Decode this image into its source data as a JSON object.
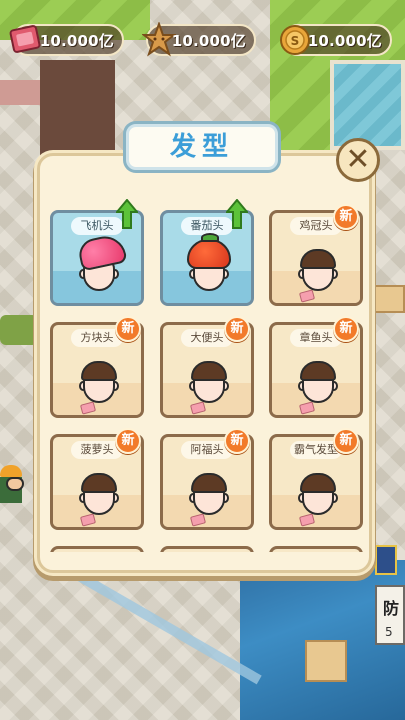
{
  "currency": [
    {
      "icon": "ticket-icon",
      "value": "10.000亿"
    },
    {
      "icon": "star-cookie-icon",
      "value": "10.000亿"
    },
    {
      "icon": "coin-icon",
      "value": "10.000亿"
    }
  ],
  "modal": {
    "title": "发型",
    "close_icon": "close-icon"
  },
  "hairstyles": [
    {
      "name": "飞机头",
      "state": "owned",
      "badge": "upgrade-arrow"
    },
    {
      "name": "番茄头",
      "state": "owned",
      "badge": "upgrade-arrow"
    },
    {
      "name": "鸡冠头",
      "state": "locked",
      "badge": "新"
    },
    {
      "name": "方块头",
      "state": "locked",
      "badge": "新"
    },
    {
      "name": "大便头",
      "state": "locked",
      "badge": "新"
    },
    {
      "name": "章鱼头",
      "state": "locked",
      "badge": "新"
    },
    {
      "name": "菠萝头",
      "state": "locked",
      "badge": "新"
    },
    {
      "name": "阿福头",
      "state": "locked",
      "badge": "新"
    },
    {
      "name": "霸气发型",
      "state": "locked",
      "badge": "新"
    }
  ],
  "background": {
    "sign_char": "防",
    "sign_num": "5"
  },
  "colors": {
    "title_text": "#3c9ed8",
    "new_badge": "#f27a2a",
    "upgrade_arrow": "#5cc23a",
    "owned_card": "#a9dbe8"
  }
}
